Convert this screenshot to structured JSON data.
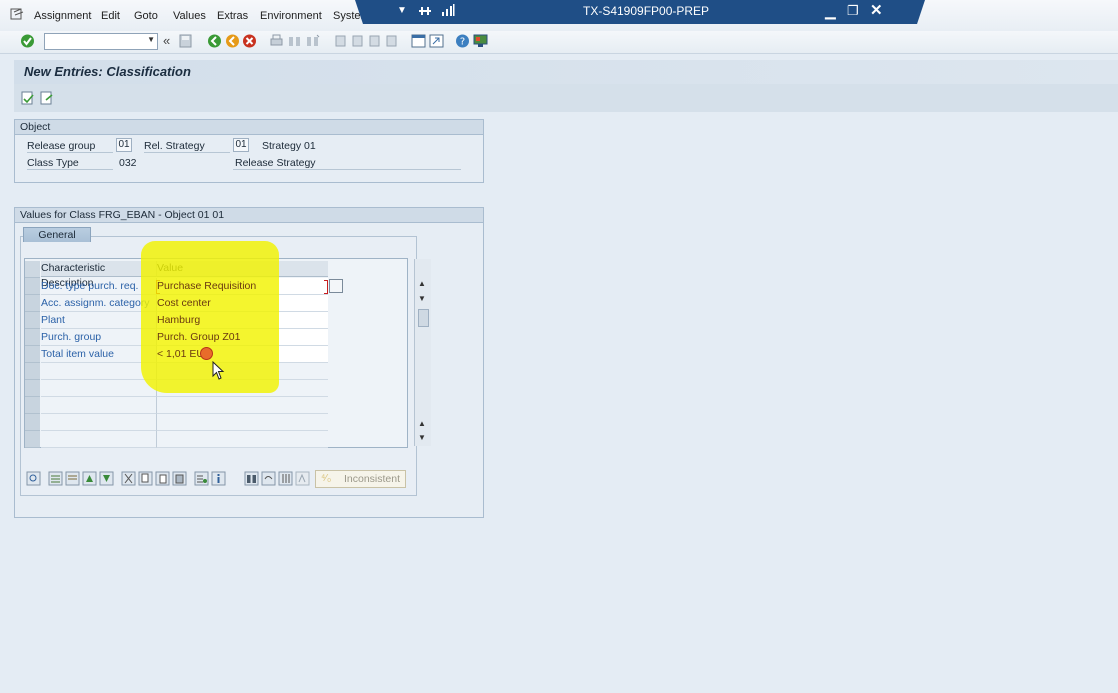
{
  "menu": {
    "items": [
      "Assignment",
      "Edit",
      "Goto",
      "Values",
      "Extras",
      "Environment",
      "System"
    ]
  },
  "window": {
    "title": "TX-S41909FP00-PREP"
  },
  "page": {
    "title": "New Entries: Classification"
  },
  "object_group": {
    "header": "Object",
    "release_group_label": "Release group",
    "release_group_value": "01",
    "rel_strategy_label": "Rel. Strategy",
    "rel_strategy_value": "01",
    "rel_strategy_text": "Strategy 01",
    "class_type_label": "Class Type",
    "class_type_value": "032",
    "release_strategy_text": "Release Strategy"
  },
  "values_group": {
    "header": "Values for Class FRG_EBAN - Object 01 01",
    "tab_label": "General",
    "columns": [
      "Characteristic Description",
      "Value"
    ],
    "rows": [
      {
        "desc": "Doc. type purch. req.",
        "value": "Purchase Requisition"
      },
      {
        "desc": "Acc. assignm. category",
        "value": "Cost center"
      },
      {
        "desc": "Plant",
        "value": "Hamburg"
      },
      {
        "desc": "Purch. group",
        "value": "Purch. Group Z01"
      },
      {
        "desc": "Total item value",
        "value": "< 1,01 EUR"
      }
    ],
    "inconsistent_label": "Inconsistent"
  },
  "colors": {
    "title_bar": "#1f4e86",
    "highlight": "#f2f300",
    "link_text": "#2c62a8"
  }
}
